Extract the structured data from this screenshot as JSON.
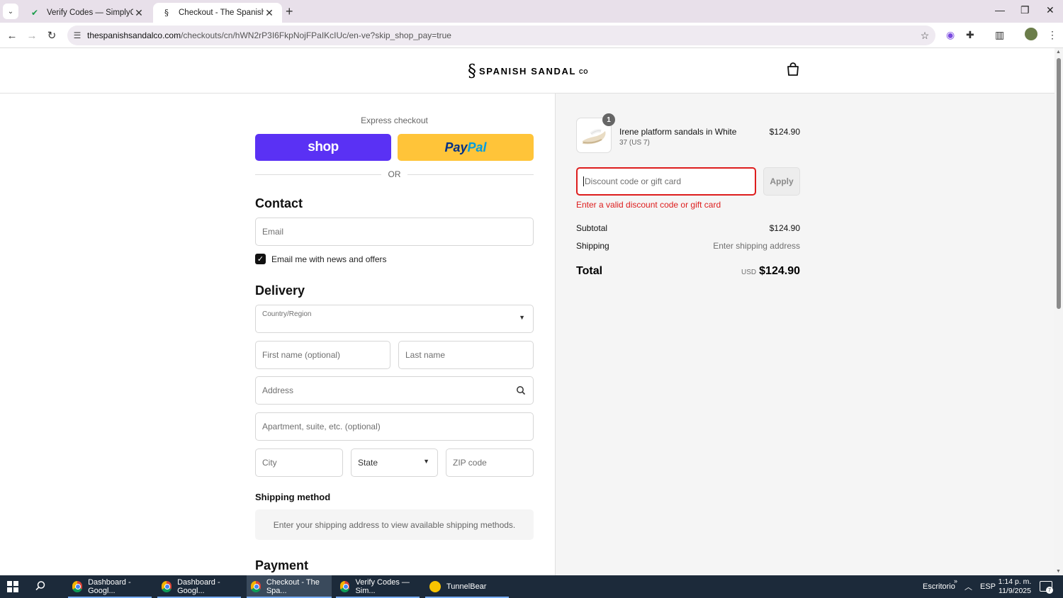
{
  "browser": {
    "tabs": [
      {
        "title": "Verify Codes — SimplyCodes",
        "icon": "simplycodes-icon"
      },
      {
        "title": "Checkout - The Spanish Sandal",
        "icon": "spanish-sandal-icon"
      }
    ],
    "url_host": "thespanishsandalco.com",
    "url_path": "/checkouts/cn/hWN2rP3I6FkpNojFPaIKcIUc/en-ve?skip_shop_pay=true"
  },
  "header": {
    "logo_text": "SPANISH SANDAL",
    "logo_suffix": "CO"
  },
  "checkout": {
    "express_label": "Express checkout",
    "shop_label": "shop",
    "paypal_pay": "Pay",
    "paypal_pal": "Pal",
    "or_label": "OR",
    "contact_title": "Contact",
    "email_placeholder": "Email",
    "news_label": "Email me with news and offers",
    "news_checked": true,
    "delivery_title": "Delivery",
    "country_label": "Country/Region",
    "first_name_placeholder": "First name (optional)",
    "last_name_placeholder": "Last name",
    "address_placeholder": "Address",
    "apartment_placeholder": "Apartment, suite, etc. (optional)",
    "city_placeholder": "City",
    "state_placeholder": "State",
    "zip_placeholder": "ZIP code",
    "shipping_method_title": "Shipping method",
    "shipping_method_note": "Enter your shipping address to view available shipping methods.",
    "payment_title": "Payment"
  },
  "summary": {
    "item": {
      "quantity": "1",
      "name": "Irene platform sandals in White",
      "variant": "37 (US 7)",
      "price": "$124.90"
    },
    "discount_placeholder": "Discount code or gift card",
    "apply_label": "Apply",
    "error_text": "Enter a valid discount code or gift card",
    "subtotal_label": "Subtotal",
    "subtotal_value": "$124.90",
    "shipping_label": "Shipping",
    "shipping_value": "Enter shipping address",
    "total_label": "Total",
    "total_currency": "USD",
    "total_value": "$124.90"
  },
  "taskbar": {
    "items": [
      {
        "label": "Dashboard - Googl...",
        "active": false
      },
      {
        "label": "Dashboard - Googl...",
        "active": false
      },
      {
        "label": "Checkout - The Spa...",
        "active": true
      },
      {
        "label": "Verify Codes — Sim...",
        "active": false
      },
      {
        "label": "TunnelBear",
        "active": false
      }
    ],
    "desktop_label": "Escritorio",
    "language": "ESP",
    "time": "1:14 p. m.",
    "date": "11/9/2025",
    "notification_count": "7"
  },
  "colors": {
    "shop_purple": "#5a31f4",
    "paypal_yellow": "#ffc439",
    "error_red": "#dd1d1d"
  }
}
